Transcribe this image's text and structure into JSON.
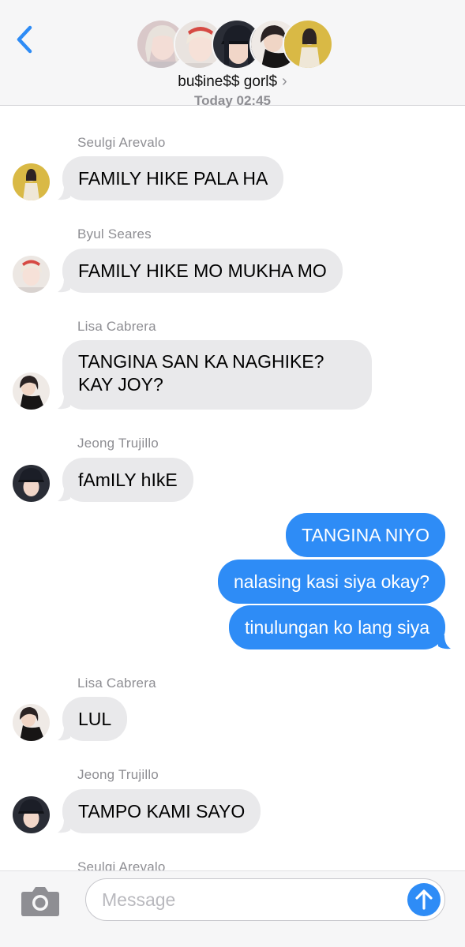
{
  "header": {
    "group_name": "bu$ine$$ gorl$",
    "chevron": "›",
    "timestamp": "Today 02:45",
    "back_icon": "chevron-left-icon",
    "member_avatars": [
      "member-avatar-1",
      "member-avatar-2",
      "member-avatar-3",
      "member-avatar-4",
      "member-avatar-5"
    ]
  },
  "messages": [
    {
      "sender": "Seulgi Arevalo",
      "text": "FAMILY HIKE PALA HA",
      "direction": "incoming"
    },
    {
      "sender": "Byul Seares",
      "text": "FAMILY HIKE MO MUKHA MO",
      "direction": "incoming"
    },
    {
      "sender": "Lisa Cabrera",
      "text": "TANGINA SAN KA NAGHIKE? KAY JOY?",
      "direction": "incoming"
    },
    {
      "sender": "Jeong Trujillo",
      "text": "fAmILY hIkE",
      "direction": "incoming"
    },
    {
      "text": "TANGINA NIYO",
      "direction": "outgoing"
    },
    {
      "text": "nalasing kasi siya okay?",
      "direction": "outgoing"
    },
    {
      "text": "tinulungan ko lang siya",
      "direction": "outgoing"
    },
    {
      "sender": "Lisa Cabrera",
      "text": "LUL",
      "direction": "incoming"
    },
    {
      "sender": "Jeong Trujillo",
      "text": "TAMPO KAMI SAYO",
      "direction": "incoming"
    },
    {
      "sender": "Seulgi Arevalo",
      "direction": "incoming"
    }
  ],
  "composer": {
    "placeholder": "Message",
    "camera_icon": "camera-icon",
    "send_icon": "arrow-up-icon"
  },
  "colors": {
    "outgoing_bubble": "#2e8cf6",
    "incoming_bubble": "#e9e9eb",
    "accent": "#2e8cf6"
  }
}
